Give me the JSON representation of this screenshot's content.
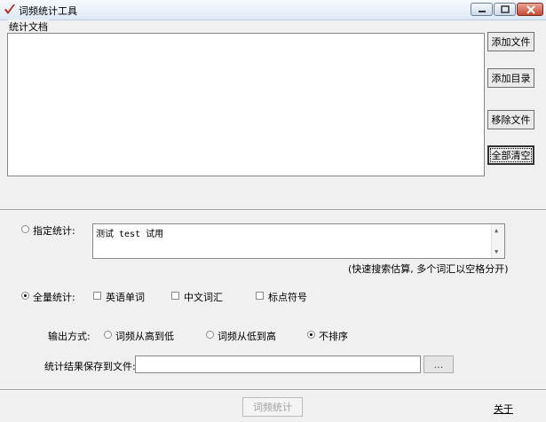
{
  "window": {
    "title": "词频统计工具",
    "controls": [
      "minimize",
      "maximize",
      "close"
    ]
  },
  "documents": {
    "group_label": "统计文档",
    "add_file_label": "添加文件",
    "add_dir_label": "添加目录",
    "remove_file_label": "移除文件",
    "clear_all_label": "全部清空"
  },
  "specified": {
    "label": "指定统计:",
    "selected": false,
    "text_value": "测试 test 试用",
    "hint": "(快速搜索估算, 多个词汇以空格分开)"
  },
  "full": {
    "label": "全量统计:",
    "selected": true,
    "options": [
      {
        "label": "英语单词",
        "checked": false
      },
      {
        "label": "中文词汇",
        "checked": false
      },
      {
        "label": "标点符号",
        "checked": false
      }
    ]
  },
  "output": {
    "label": "输出方式:",
    "options": [
      {
        "label": "词频从高到低",
        "selected": false
      },
      {
        "label": "词频从低到高",
        "selected": false
      },
      {
        "label": "不排序",
        "selected": true
      }
    ]
  },
  "save": {
    "label": "统计结果保存到文件:",
    "value": "",
    "browse_label": "..."
  },
  "footer": {
    "run_label": "词频统计",
    "about_label": "关于"
  },
  "colors": {
    "window_bg": "#f0f0f0",
    "close_button": "#c74a34",
    "disabled_text": "#a0a0a0"
  }
}
